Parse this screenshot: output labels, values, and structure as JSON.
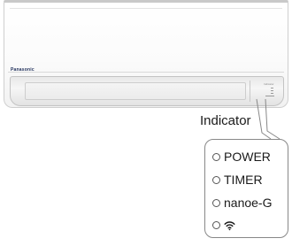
{
  "unit": {
    "brand_label": "Panasonic",
    "panel_label": "Indicator"
  },
  "callout": {
    "title": "Indicator"
  },
  "indicators": [
    {
      "label": "POWER",
      "icon": "led-circle-icon"
    },
    {
      "label": "TIMER",
      "icon": "led-circle-icon"
    },
    {
      "label": "nanoe-G",
      "icon": "led-circle-icon"
    },
    {
      "label": "",
      "icon": "wifi-icon"
    }
  ],
  "colors": {
    "outline": "#888888",
    "text": "#1a1a1a"
  }
}
